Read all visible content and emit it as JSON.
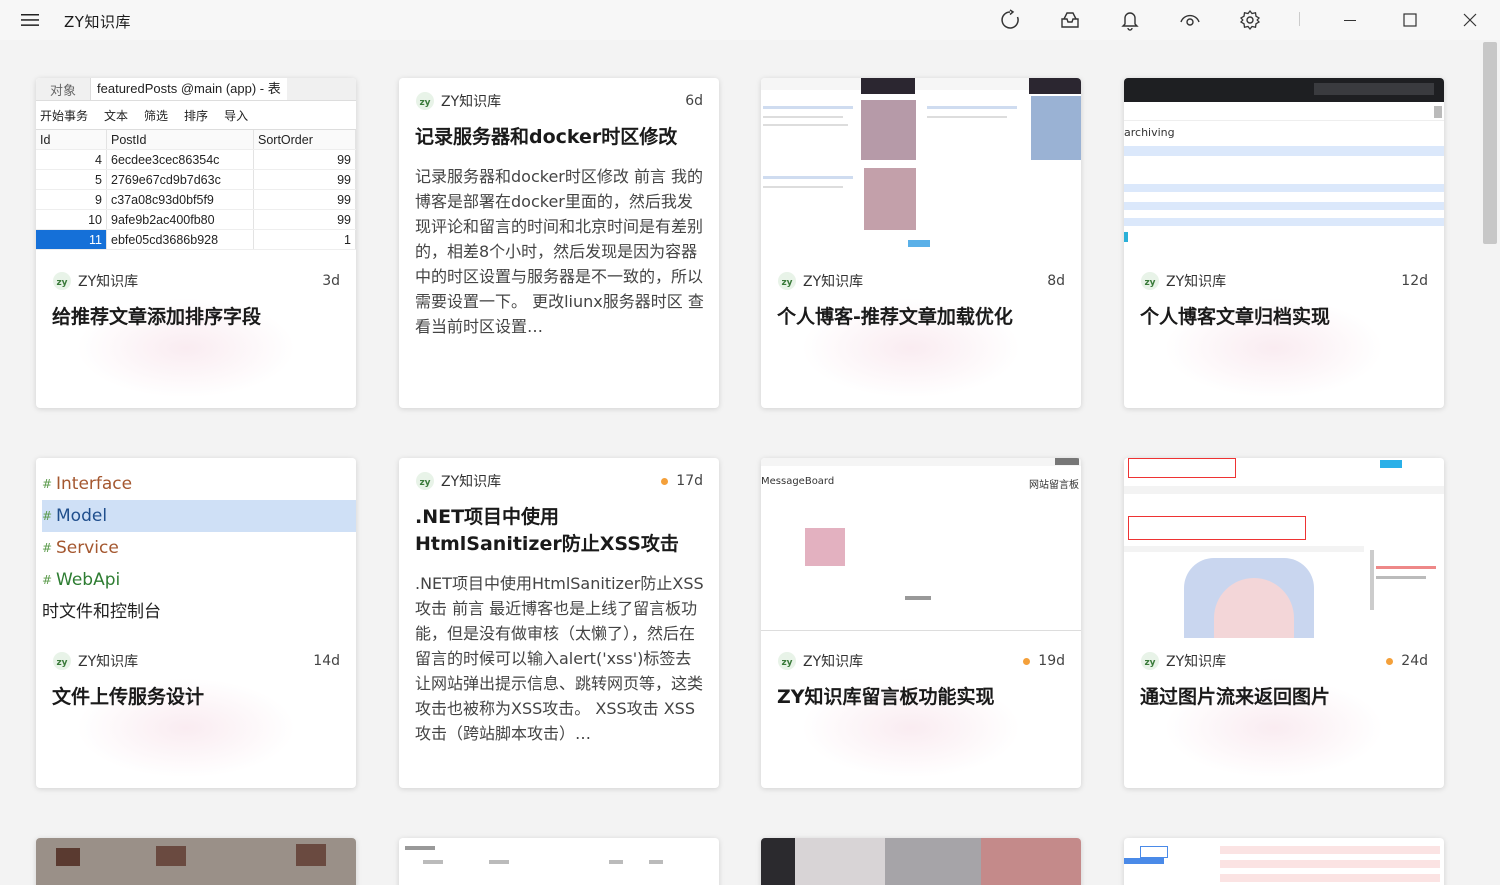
{
  "app": {
    "title": "ZY知识库",
    "colors": {
      "accent": "#1570d8",
      "badge_dot": "#f4a03a",
      "background": "#f3f3f3",
      "card": "#ffffff"
    }
  },
  "titlebar": {
    "menu_icon": "hamburger-icon",
    "icons": [
      "refresh-icon",
      "inbox-icon",
      "bell-icon",
      "eye-icon",
      "gear-icon"
    ],
    "window_controls": [
      "minimize-icon",
      "maximize-icon",
      "close-icon"
    ]
  },
  "cards": [
    {
      "author": "ZY知识库",
      "age": "3d",
      "title": "给推荐文章添加排序字段",
      "summary": "",
      "dot": false,
      "thumb": "table"
    },
    {
      "author": "ZY知识库",
      "age": "6d",
      "title": "记录服务器和docker时区修改",
      "summary": "记录服务器和docker时区修改 前言 我的博客是部署在docker里面的，然后我发现评论和留言的时间和北京时间是有差别的，相差8个小时，然后发现是因为容器中的时区设置与服务器是不一致的，所以需要设置一下。 更改liunx服务器时区 查看当前时区设置…",
      "dot": false,
      "thumb": "none"
    },
    {
      "author": "ZY知识库",
      "age": "8d",
      "title": "个人博客-推荐文章加载优化",
      "summary": "",
      "dot": false,
      "thumb": "blog"
    },
    {
      "author": "ZY知识库",
      "age": "12d",
      "title": "个人博客文章归档实现",
      "summary": "",
      "dot": false,
      "thumb": "archive"
    },
    {
      "author": "ZY知识库",
      "age": "14d",
      "title": "文件上传服务设计",
      "summary": "",
      "dot": false,
      "thumb": "tree"
    },
    {
      "author": "ZY知识库",
      "age": "17d",
      "title": ".NET项目中使用HtmlSanitizer防止XSS攻击",
      "summary": ".NET项目中使用HtmlSanitizer防止XSS攻击 前言 最近博客也是上线了留言板功能，但是没有做审核（太懒了），然后在留言的时候可以输入alert('xss')标签去让网站弹出提示信息、跳转网页等，这类攻击也被称为XSS攻击。 XSS攻击 XSS攻击（跨站脚本攻击）…",
      "dot": true,
      "thumb": "none"
    },
    {
      "author": "ZY知识库",
      "age": "19d",
      "title": "ZY知识库留言板功能实现",
      "summary": "",
      "dot": true,
      "thumb": "message"
    },
    {
      "author": "ZY知识库",
      "age": "24d",
      "title": "通过图片流来返回图片",
      "summary": "",
      "dot": true,
      "thumb": "devtools"
    }
  ],
  "thumb_table": {
    "tabs": [
      "对象",
      "featuredPosts @main (app) - 表"
    ],
    "toolbar": [
      "开始事务",
      "文本",
      "筛选",
      "排序",
      "导入"
    ],
    "columns": [
      "Id",
      "PostId",
      "SortOrder"
    ],
    "rows": [
      [
        "4",
        "6ecdee3cec86354c",
        "99"
      ],
      [
        "5",
        "2769e67cd9b7d63c",
        "99"
      ],
      [
        "9",
        "c37a08c93d0bf5f9",
        "99"
      ],
      [
        "10",
        "9afe9b2ac400fb80",
        "99"
      ],
      [
        "11",
        "ebfe05cd3686b928",
        "1"
      ]
    ]
  },
  "thumb_tree": {
    "items": [
      "Interface",
      "Model",
      "Service",
      "WebApi"
    ],
    "selected": "Model",
    "footer": "时文件和控制台"
  },
  "thumb_archive": {
    "label": "archiving"
  },
  "thumb_message": {
    "label": "MessageBoard",
    "label_right": "网站留言板"
  }
}
